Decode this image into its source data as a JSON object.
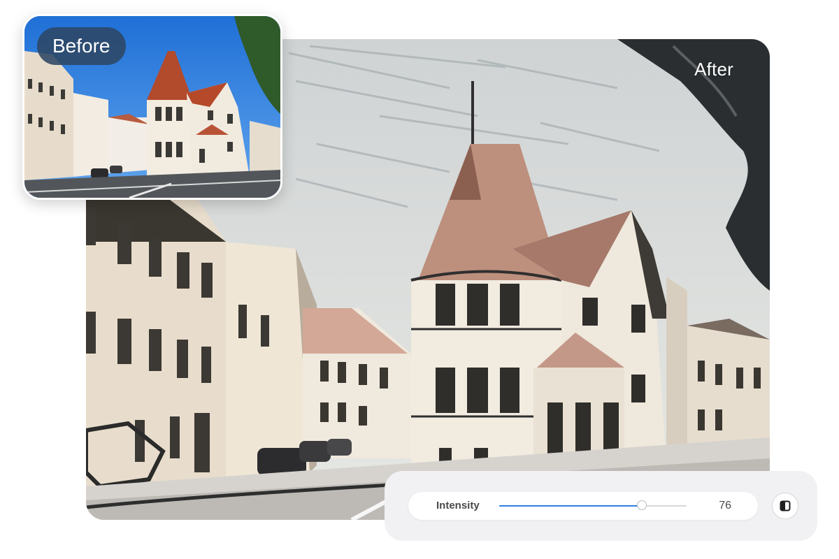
{
  "labels": {
    "before": "Before",
    "after": "After"
  },
  "control": {
    "label": "Intensity",
    "value": "76",
    "fraction": 0.76
  },
  "icons": {
    "compare": "split-compare-icon"
  },
  "colors": {
    "accent": "#2f7fe0",
    "panel_bg": "#f1f1f3",
    "before_pill_bg": "#2e4764"
  }
}
